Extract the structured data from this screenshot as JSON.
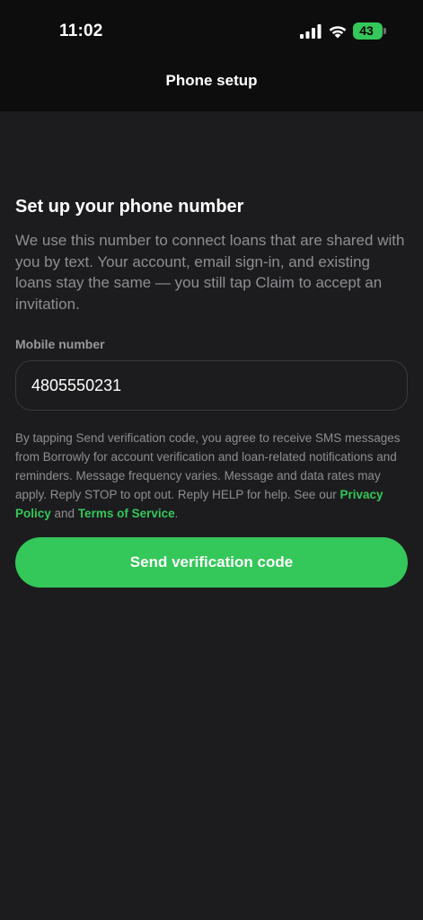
{
  "status_bar": {
    "time": "11:02",
    "battery_level": "43",
    "battery_color": "#34c759"
  },
  "nav": {
    "title": "Phone setup"
  },
  "main": {
    "heading": "Set up your phone number",
    "description": "We use this number to connect loans that are shared with you by text. Your account, email sign-in, and existing loans stay the same — you still tap Claim to accept an invitation.",
    "mobile_label": "Mobile number",
    "mobile_value": "4805550231",
    "legal": {
      "text_before": "By tapping Send verification code, you agree to receive SMS messages from Borrowly for account verification and loan-related notifications and reminders. Message frequency varies. Message and data rates may apply. Reply STOP to opt out. Reply HELP for help. See our ",
      "privacy_link": "Privacy Policy",
      "middle": " and ",
      "terms_link": "Terms of Service",
      "end": "."
    },
    "send_button_label": "Send verification code"
  },
  "colors": {
    "accent": "#34c759",
    "background": "#1c1c1e",
    "header_background": "#0d0d0e"
  }
}
